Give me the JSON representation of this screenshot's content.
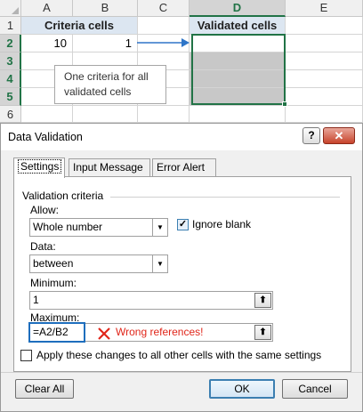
{
  "sheet": {
    "columns": [
      "A",
      "B",
      "C",
      "D",
      "E"
    ],
    "rows": [
      "1",
      "2",
      "3",
      "4",
      "5",
      "6"
    ],
    "criteria_header": "Criteria cells",
    "validated_header": "Validated cells",
    "a2": "10",
    "b2": "1",
    "note": "One criteria for all validated cells",
    "header_fill": "#dce6f1",
    "selection_color": "#217346"
  },
  "dialog": {
    "title": "Data Validation",
    "help_icon": "?",
    "close_icon": "✕",
    "tabs": [
      "Settings",
      "Input Message",
      "Error Alert"
    ],
    "group_label": "Validation criteria",
    "allow_label": "Allow:",
    "allow_value": "Whole number",
    "ignore_blank_label": "Ignore blank",
    "data_label": "Data:",
    "data_value": "between",
    "minimum_label": "Minimum:",
    "minimum_value": "1",
    "maximum_label": "Maximum:",
    "maximum_value": "=A2/B2",
    "error_note": "Wrong references!",
    "error_color": "#e0261a",
    "apply_label": "Apply these changes to all other cells with the same settings",
    "clear_all": "Clear All",
    "ok": "OK",
    "cancel": "Cancel"
  }
}
